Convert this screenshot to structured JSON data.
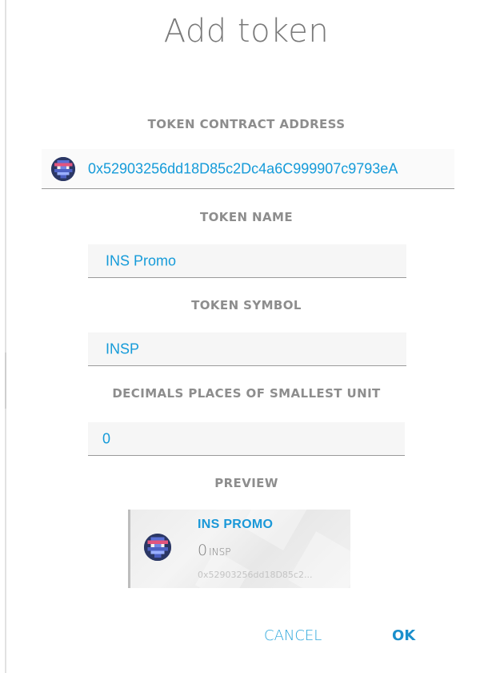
{
  "dialog": {
    "title": "Add token"
  },
  "fields": {
    "contract_address": {
      "label": "TOKEN CONTRACT ADDRESS",
      "value": "0x52903256dd18D85c2Dc4a6C999907c9793eA"
    },
    "token_name": {
      "label": "TOKEN NAME",
      "value": "INS Promo"
    },
    "token_symbol": {
      "label": "TOKEN SYMBOL",
      "value": "INSP"
    },
    "decimals": {
      "label": "DECIMALS PLACES OF SMALLEST UNIT",
      "value": "0"
    }
  },
  "preview": {
    "label": "PREVIEW",
    "name": "INS PROMO",
    "balance": "0",
    "unit": "INSP",
    "address": "0x52903256dd18D85c2..."
  },
  "actions": {
    "cancel_label": "CANCEL",
    "ok_label": "OK"
  },
  "colors": {
    "accent": "#159bd9",
    "label_gray": "#8d8d8d",
    "field_bg": "#f6f6f6"
  },
  "icons": {
    "address_identicon": "identicon-icon",
    "preview_identicon": "identicon-icon"
  }
}
